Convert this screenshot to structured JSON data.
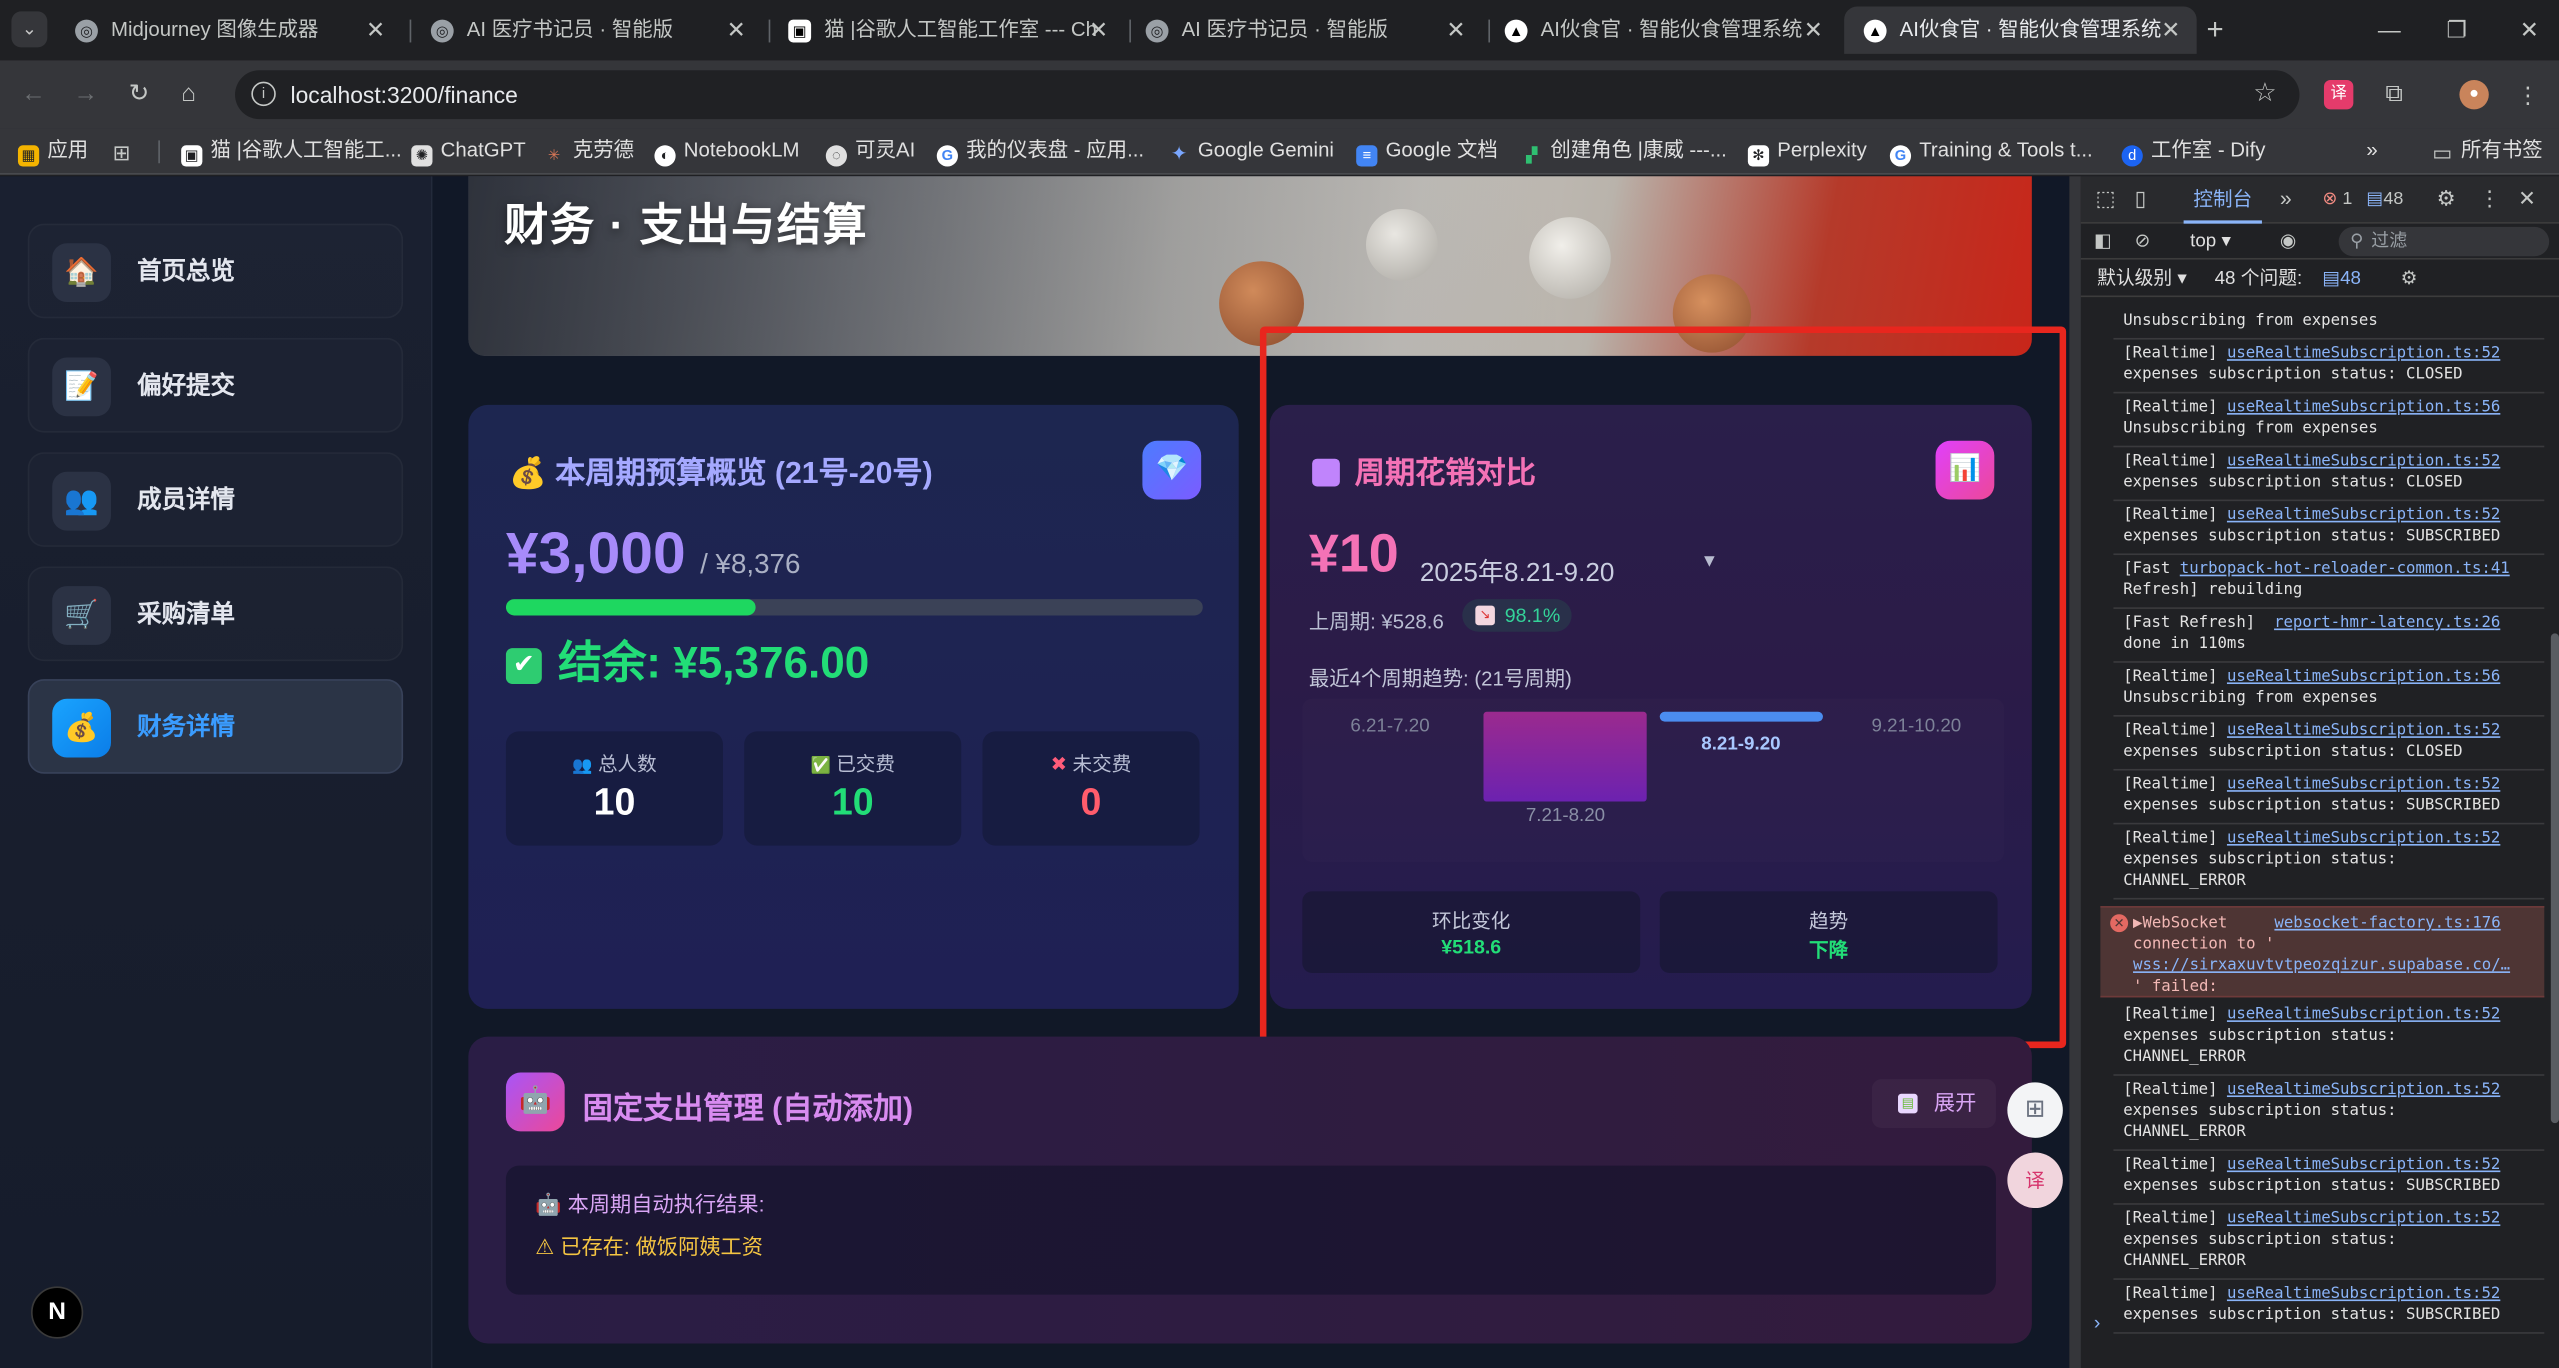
{
  "browser": {
    "tabs": [
      {
        "title": "Midjourney 图像生成器",
        "active": false
      },
      {
        "title": "AI 医疗书记员 · 智能版",
        "active": false
      },
      {
        "title": "猫 |谷歌人工智能工作室 --- Ch",
        "active": false
      },
      {
        "title": "AI 医疗书记员 · 智能版",
        "active": false
      },
      {
        "title": "AI伙食官 · 智能伙食管理系统",
        "active": false
      },
      {
        "title": "AI伙食官 · 智能伙食管理系统",
        "active": true
      }
    ],
    "new_tab": "+",
    "url": "localhost:3200/finance",
    "bookmarks": [
      "应用",
      "猫 |谷歌人工智能工...",
      "ChatGPT",
      "克劳德",
      "NotebookLM",
      "可灵AI",
      "我的仪表盘 - 应用...",
      "Google Gemini",
      "Google 文档",
      "创建角色 |康威 ---...",
      "Perplexity",
      "Training & Tools t...",
      "工作室 - Dify"
    ],
    "more_bookmarks": "»",
    "all_bookmarks": "所有书签"
  },
  "sidebar": {
    "items": [
      {
        "label": "首页总览",
        "icon": "house-icon",
        "glyph": "🏠"
      },
      {
        "label": "偏好提交",
        "icon": "memo-icon",
        "glyph": "📝"
      },
      {
        "label": "成员详情",
        "icon": "people-icon",
        "glyph": "👥"
      },
      {
        "label": "采购清单",
        "icon": "cart-icon",
        "glyph": "🛒"
      },
      {
        "label": "财务详情",
        "icon": "money-bag-icon",
        "glyph": "💰",
        "active": true
      }
    ],
    "next_badge": "N"
  },
  "hero": {
    "title": "财务 · 支出与结算"
  },
  "budget_card": {
    "title": "本周期预算概览 (21号-20号)",
    "amount": "¥3,000",
    "total": "/ ¥8,376",
    "progress": 0.358,
    "balance": "结余: ¥5,376.00",
    "stats": [
      {
        "label": "总人数",
        "value": "10",
        "icon": "people-icon",
        "glyph": "👥",
        "color": "#ffffff"
      },
      {
        "label": "已交费",
        "value": "10",
        "icon": "check-icon",
        "glyph": "✅",
        "color": "#22dd77"
      },
      {
        "label": "未交费",
        "value": "0",
        "icon": "cross-icon",
        "glyph": "✖",
        "color": "#ff5c6c"
      }
    ]
  },
  "compare_card": {
    "title": "周期花销对比",
    "amount": "¥10",
    "range": "2025年8.21-9.20",
    "dropdown": "▼",
    "previous": "上周期: ¥528.6",
    "change_pct": "98.1%",
    "trend_label": "最近4个周期趋势: (21号周期)",
    "chart_data": {
      "type": "bar",
      "categories": [
        "6.21-7.20",
        "7.21-8.20",
        "8.21-9.20",
        "9.21-10.20"
      ],
      "values": [
        0,
        528.6,
        10,
        0
      ],
      "highlight": "8.21-9.20"
    },
    "summary": [
      {
        "title": "环比变化",
        "value": "¥518.6"
      },
      {
        "title": "趋势",
        "value": "下降"
      }
    ]
  },
  "fixed_card": {
    "title": "固定支出管理 (自动添加)",
    "expand_label": "展开",
    "exec_title": "本周期自动执行结果:",
    "exec_item": "已存在: 做饭阿姨工资"
  },
  "devtools": {
    "tab": "控制台",
    "errors": "1",
    "messages": "48",
    "context": "top",
    "filter_placeholder": "过滤",
    "level": "默认级别",
    "issues_label": "48 个问题:",
    "issues_count": "48",
    "logs": [
      {
        "prefix": "",
        "link": "",
        "text": "Unsubscribing from expenses"
      },
      {
        "prefix": "[Realtime] ",
        "link": "useRealtimeSubscription.ts:52",
        "text": "expenses subscription status: CLOSED"
      },
      {
        "prefix": "[Realtime] ",
        "link": "useRealtimeSubscription.ts:56",
        "text": "Unsubscribing from expenses"
      },
      {
        "prefix": "[Realtime] ",
        "link": "useRealtimeSubscription.ts:52",
        "text": "expenses subscription status: CLOSED"
      },
      {
        "prefix": "[Realtime] ",
        "link": "useRealtimeSubscription.ts:52",
        "text": "expenses subscription status: SUBSCRIBED"
      },
      {
        "prefix": "[Fast ",
        "link": "turbopack-hot-reloader-common.ts:41",
        "text": "Refresh] rebuilding"
      },
      {
        "prefix": "[Fast Refresh]  ",
        "link": "report-hmr-latency.ts:26",
        "text": "done in 110ms"
      },
      {
        "prefix": "[Realtime] ",
        "link": "useRealtimeSubscription.ts:56",
        "text": "Unsubscribing from expenses"
      },
      {
        "prefix": "[Realtime] ",
        "link": "useRealtimeSubscription.ts:52",
        "text": "expenses subscription status: CLOSED"
      },
      {
        "prefix": "[Realtime] ",
        "link": "useRealtimeSubscription.ts:52",
        "text": "expenses subscription status: SUBSCRIBED"
      },
      {
        "prefix": "[Realtime] ",
        "link": "useRealtimeSubscription.ts:52",
        "text": "expenses subscription status:\nCHANNEL_ERROR"
      }
    ],
    "error_log": {
      "prefix": "▶WebSocket     ",
      "link": "websocket-factory.ts:176",
      "text1": "connection to '",
      "url": "wss://sirxaxuvtvtpeozqizur.supabase.co/…",
      "text2": "' failed:"
    },
    "logs_after": [
      {
        "prefix": "[Realtime] ",
        "link": "useRealtimeSubscription.ts:52",
        "text": "expenses subscription status:\nCHANNEL_ERROR"
      },
      {
        "prefix": "[Realtime] ",
        "link": "useRealtimeSubscription.ts:52",
        "text": "expenses subscription status:\nCHANNEL_ERROR"
      },
      {
        "prefix": "[Realtime] ",
        "link": "useRealtimeSubscription.ts:52",
        "text": "expenses subscription status: SUBSCRIBED"
      },
      {
        "prefix": "[Realtime] ",
        "link": "useRealtimeSubscription.ts:52",
        "text": "expenses subscription status:\nCHANNEL_ERROR"
      },
      {
        "prefix": "[Realtime] ",
        "link": "useRealtimeSubscription.ts:52",
        "text": "expenses subscription status: SUBSCRIBED"
      }
    ],
    "prompt": "›"
  }
}
